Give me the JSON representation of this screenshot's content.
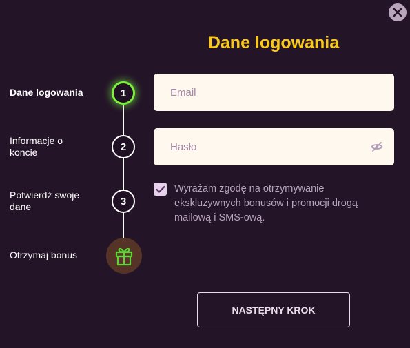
{
  "title": "Dane logowania",
  "steps": [
    {
      "label": "Dane logowania",
      "number": "1"
    },
    {
      "label": "Informacje o koncie",
      "number": "2"
    },
    {
      "label": "Potwierdź swoje dane",
      "number": "3"
    },
    {
      "label": "Otrzymaj bonus"
    }
  ],
  "form": {
    "email_placeholder": "Email",
    "password_placeholder": "Hasło",
    "consent_text": "Wyrażam zgodę na otrzymywanie ekskluzywnych bonusów i promocji drogą mailową i SMS-ową.",
    "consent_checked": true
  },
  "next_button_label": "NASTĘPNY KROK",
  "icons": [
    "close-icon",
    "eye-off-icon",
    "checkmark-icon",
    "gift-icon"
  ],
  "colors": {
    "background": "#241428",
    "title": "#f8c81a",
    "active_step_glow": "#7ef03c",
    "field_bg": "#fff8ef",
    "gift_green": "#5fd33a"
  }
}
